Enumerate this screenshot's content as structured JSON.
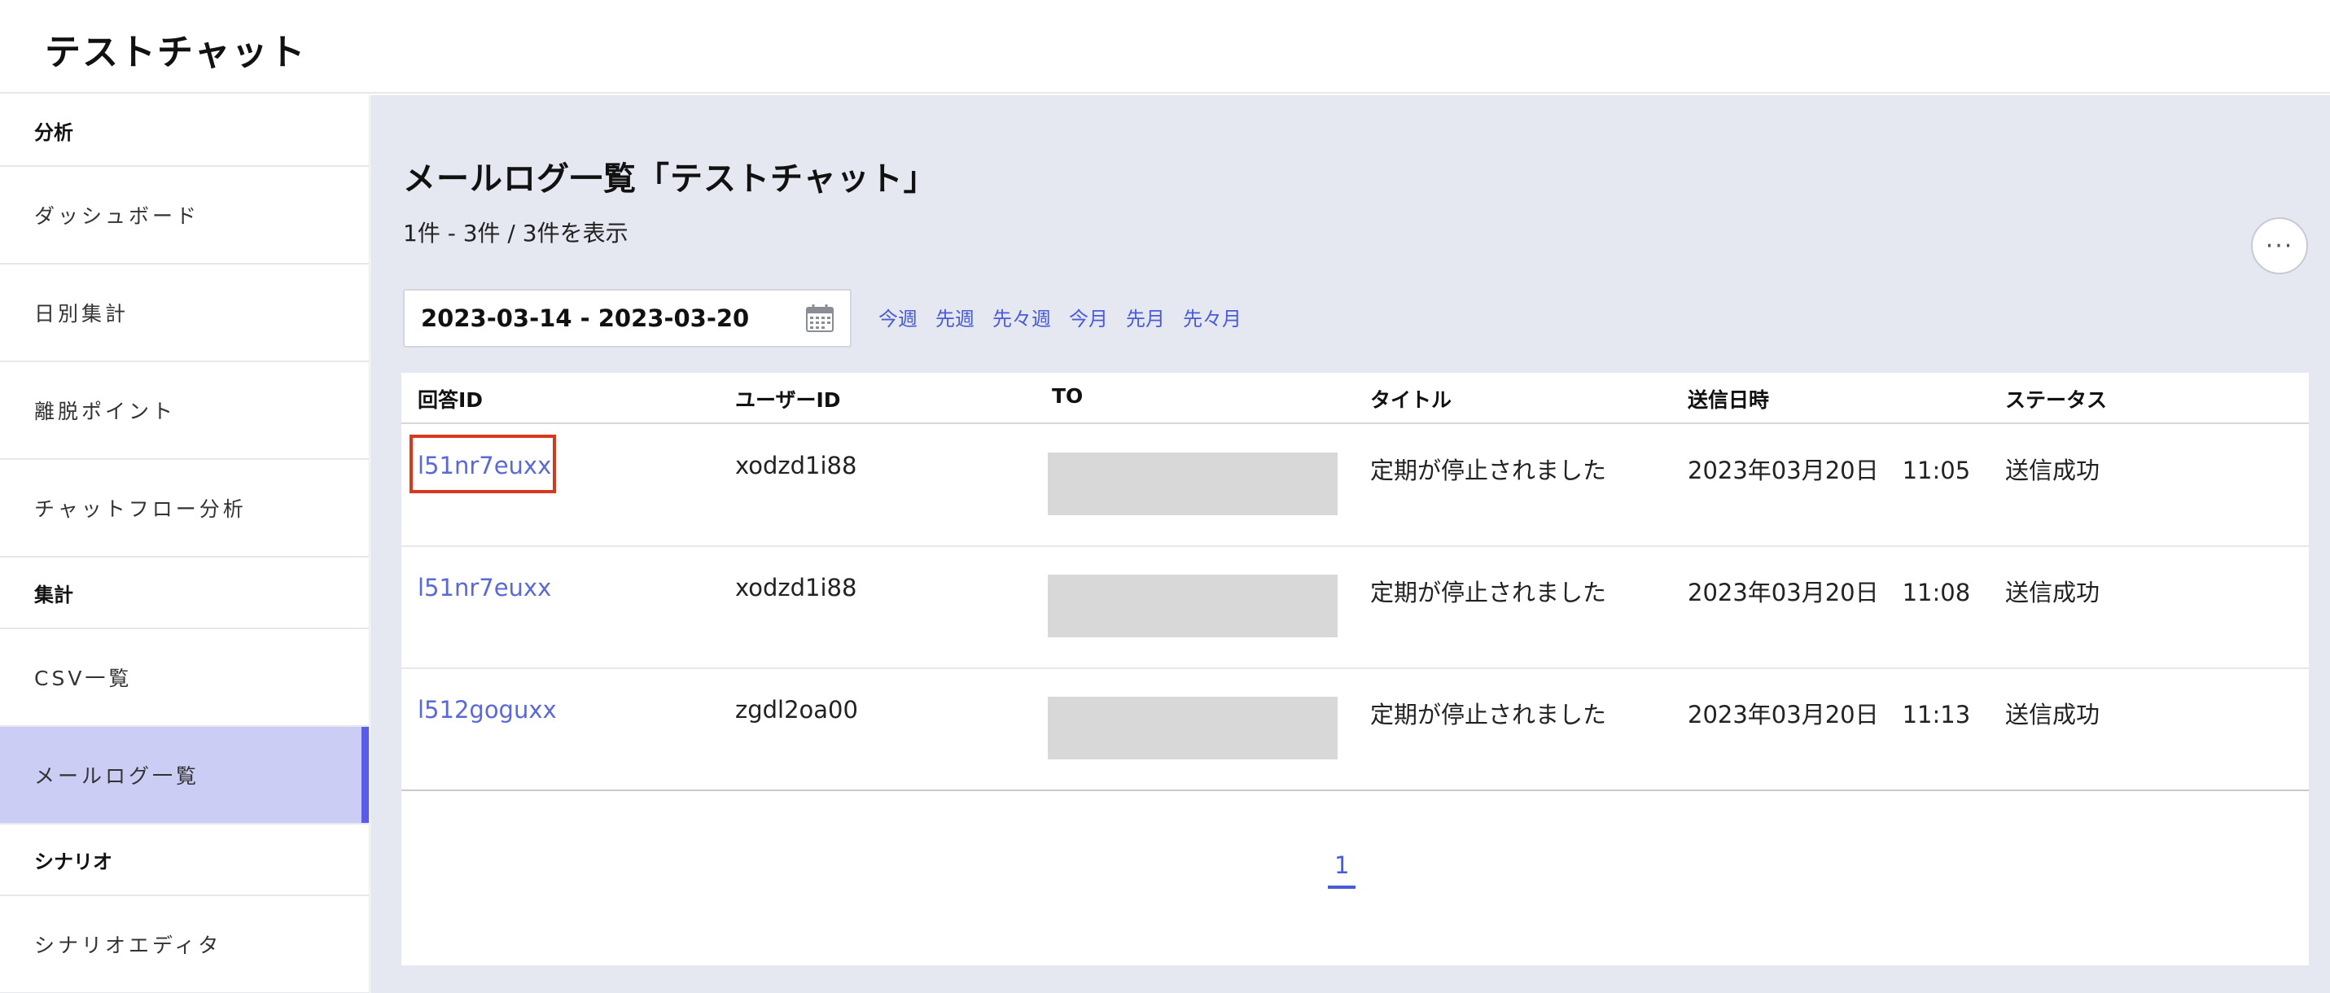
{
  "app": {
    "title": "テストチャット"
  },
  "sidebar": {
    "sections": [
      {
        "label": "分析",
        "items": [
          {
            "label": "ダッシュボード"
          },
          {
            "label": "日別集計"
          },
          {
            "label": "離脱ポイント"
          },
          {
            "label": "チャットフロー分析"
          }
        ]
      },
      {
        "label": "集計",
        "items": [
          {
            "label": "CSV一覧"
          },
          {
            "label": "メールログ一覧",
            "active": true
          }
        ]
      },
      {
        "label": "シナリオ",
        "items": [
          {
            "label": "シナリオエディタ"
          }
        ]
      }
    ]
  },
  "main": {
    "page_title": "メールログ一覧「テストチャット」",
    "count_text": "1件 - 3件 / 3件を表示",
    "more_icon": "ellipsis-icon",
    "more_label": "···",
    "date_range": {
      "value": "2023-03-14 - 2023-03-20",
      "icon": "calendar-icon"
    },
    "quick_links": [
      "今週",
      "先週",
      "先々週",
      "今月",
      "先月",
      "先々月"
    ],
    "table": {
      "columns": [
        "回答ID",
        "ユーザーID",
        "TO",
        "タイトル",
        "送信日時",
        "ステータス"
      ],
      "rows": [
        {
          "answer_id": "l51nr7euxx",
          "user_id": "xodzd1i88",
          "to": "",
          "title": "定期が停止されました",
          "sent_at": "2023年03月20日　11:05",
          "status": "送信成功"
        },
        {
          "answer_id": "l51nr7euxx",
          "user_id": "xodzd1i88",
          "to": "",
          "title": "定期が停止されました",
          "sent_at": "2023年03月20日　11:08",
          "status": "送信成功"
        },
        {
          "answer_id": "l512goguxx",
          "user_id": "zgdl2oa00",
          "to": "",
          "title": "定期が停止されました",
          "sent_at": "2023年03月20日　11:13",
          "status": "送信成功"
        }
      ]
    },
    "pagination": {
      "current": "1"
    },
    "colors": {
      "accent": "#5a5be6",
      "link": "#4a5bd8",
      "active_bg": "#cbcdf5",
      "highlight": "#d6391e",
      "page_bg": "#e5e8f0"
    }
  }
}
